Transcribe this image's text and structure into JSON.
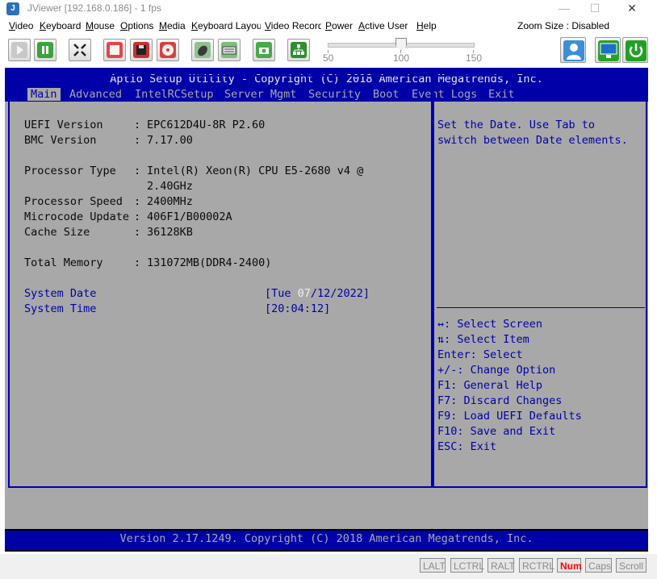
{
  "window": {
    "title": "JViewer [192.168.0.186] - 1 fps",
    "minimize": "—",
    "maximize": "☐",
    "close": "✕"
  },
  "menu": {
    "items": [
      "Video",
      "Keyboard",
      "Mouse",
      "Options",
      "Media",
      "Keyboard Layout",
      "Video Record",
      "Power",
      "Active User",
      "Help"
    ],
    "zoom_size": "Zoom Size : Disabled"
  },
  "toolbar": {
    "slider_labels": [
      "50",
      "100",
      "150"
    ],
    "zoom_value": 100
  },
  "bios": {
    "title": "Aptio Setup Utility - Copyright (C) 2018 American Megatrends, Inc.",
    "tabs": [
      "Main",
      "Advanced",
      "IntelRCSetup",
      "Server Mgmt",
      "Security",
      "Boot",
      "Event Logs",
      "Exit"
    ],
    "info": [
      {
        "label": "UEFI Version",
        "value": "EPC612D4U-8R P2.60"
      },
      {
        "label": "BMC Version",
        "value": "7.17.00"
      },
      {
        "label": "Processor Type",
        "value": "Intel(R) Xeon(R) CPU E5-2680 v4 @",
        "value2": "2.40GHz"
      },
      {
        "label": "Processor Speed",
        "value": "2400MHz"
      },
      {
        "label": "Microcode Update",
        "value": "406F1/B00002A"
      },
      {
        "label": "Cache Size",
        "value": "36128KB"
      },
      {
        "label": "Total Memory",
        "value": "131072MB(DDR4-2400)"
      }
    ],
    "system_date_label": "System Date",
    "system_date_pre": "[Tue ",
    "system_date_sel": "07",
    "system_date_post": "/12/2022]",
    "system_time_label": "System Time",
    "system_time_value": "[20:04:12]",
    "help_line1": "Set the Date. Use Tab to",
    "help_line2": "switch between Date elements.",
    "keys": [
      "↔: Select Screen",
      "⇅: Select Item",
      "Enter: Select",
      "+/-: Change Option",
      "F1: General Help",
      "F7: Discard Changes",
      "F9: Load UEFI Defaults",
      "F10: Save and Exit",
      "ESC: Exit"
    ],
    "footer": "Version 2.17.1249. Copyright (C) 2018 American Megatrends, Inc."
  },
  "status": {
    "keys": [
      "LALT",
      "LCTRL",
      "RALT",
      "RCTRL",
      "Num",
      "Caps",
      "Scroll"
    ]
  },
  "colors": {
    "bios_blue": "#0000a8",
    "bios_gray": "#a8a8a8",
    "num_lock_active": "#ff0000"
  }
}
